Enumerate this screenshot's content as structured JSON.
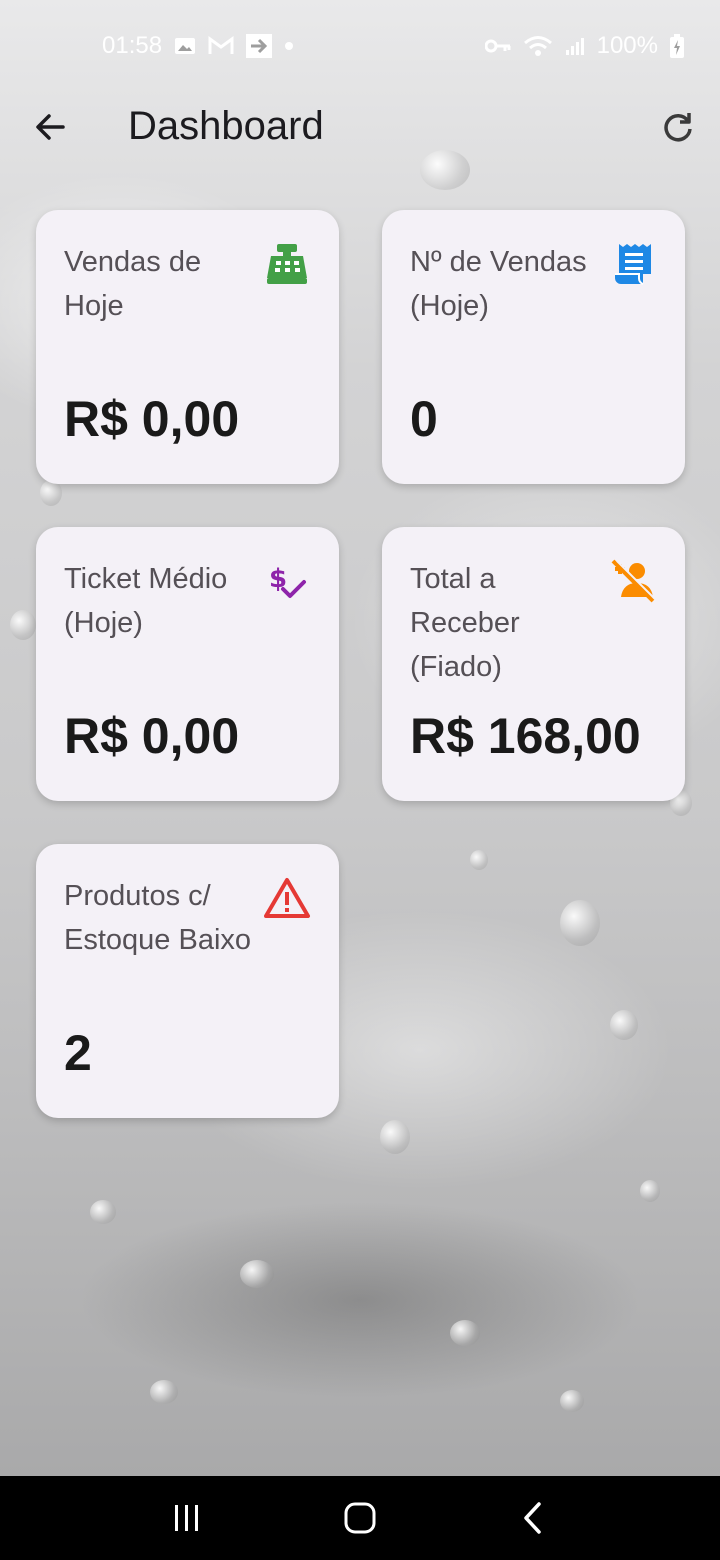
{
  "status_bar": {
    "time": "01:58",
    "battery": "100%",
    "notification_icons": [
      "image-icon",
      "gmail-icon",
      "login-icon",
      "dot-icon"
    ],
    "system_icons": [
      "key-icon",
      "wifi-icon",
      "signal-icon",
      "battery-charging-icon"
    ]
  },
  "app_bar": {
    "title": "Dashboard",
    "back_icon": "arrow-back-icon",
    "refresh_icon": "refresh-icon"
  },
  "cards": [
    {
      "label": "Vendas de Hoje",
      "value": "R$ 0,00",
      "icon": "cash-register-icon",
      "icon_color": "#43a047"
    },
    {
      "label": "Nº de Vendas (Hoje)",
      "value": "0",
      "icon": "receipt-icon",
      "icon_color": "#1e88e5"
    },
    {
      "label": "Ticket Médio (Hoje)",
      "value": "R$ 0,00",
      "icon": "price-check-icon",
      "icon_color": "#8e24aa"
    },
    {
      "label": "Total a Receber (Fiado)",
      "value": "R$ 168,00",
      "icon": "person-off-icon",
      "icon_color": "#fb8c00"
    },
    {
      "label": "Produtos c/ Estoque Baixo",
      "value": "2",
      "icon": "warning-icon",
      "icon_color": "#e53935"
    }
  ],
  "nav_bar": {
    "buttons": [
      "recent-apps-icon",
      "home-icon",
      "back-icon"
    ]
  }
}
